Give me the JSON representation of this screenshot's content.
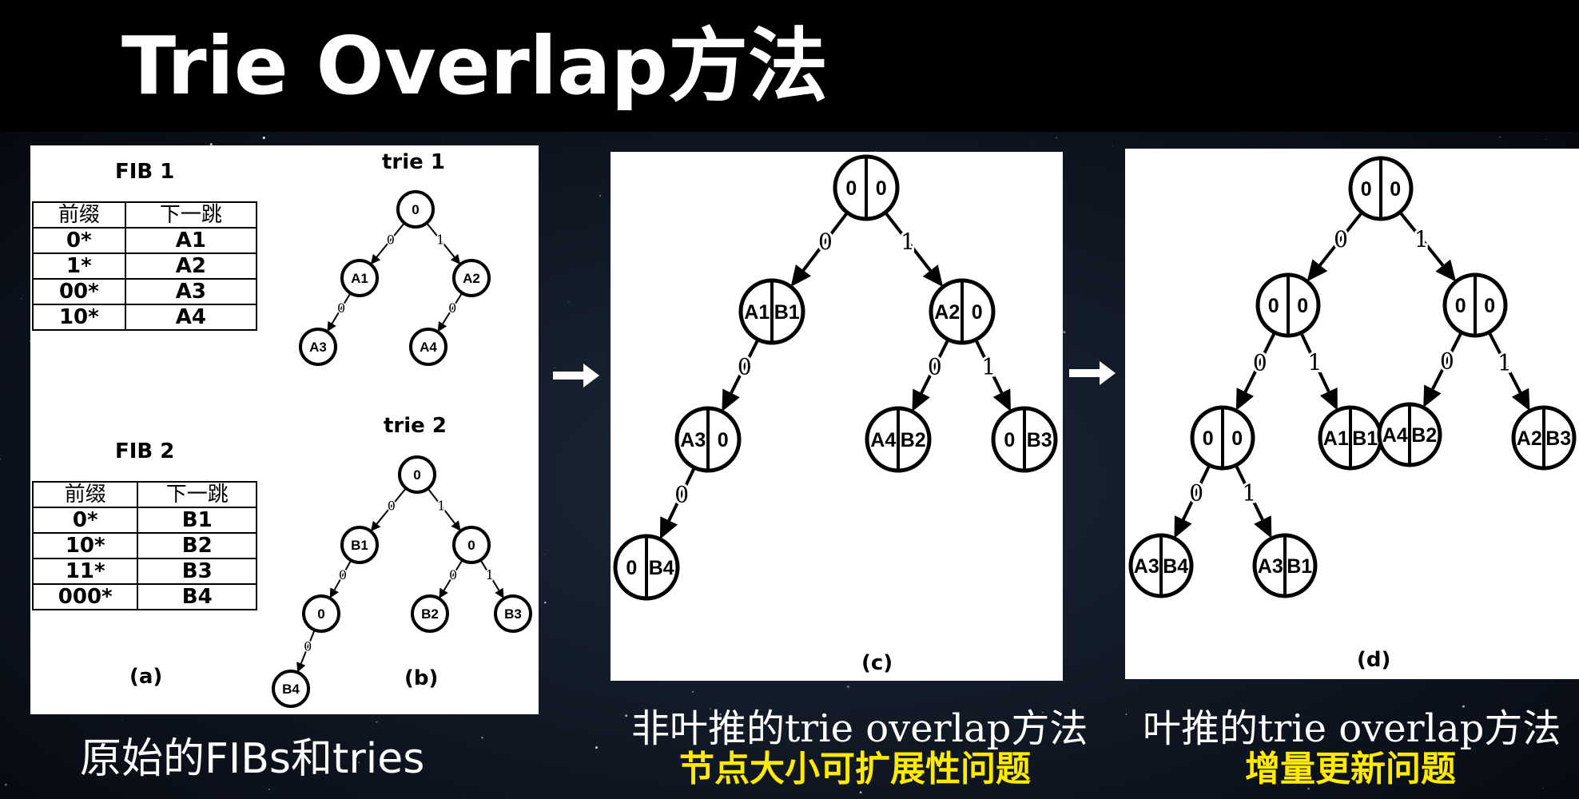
{
  "slide": {
    "title": "Trie Overlap方法"
  },
  "panel_a": {
    "fib1_title": "FIB 1",
    "fib2_title": "FIB 2",
    "col_prefix": "前缀",
    "col_nexthop": "下一跳",
    "fib1_rows": [
      [
        "0*",
        "A1"
      ],
      [
        "1*",
        "A2"
      ],
      [
        "00*",
        "A3"
      ],
      [
        "10*",
        "A4"
      ]
    ],
    "fib2_rows": [
      [
        "0*",
        "B1"
      ],
      [
        "10*",
        "B2"
      ],
      [
        "11*",
        "B3"
      ],
      [
        "000*",
        "B4"
      ]
    ],
    "label_a": "(a)",
    "trie1_title": "trie 1",
    "trie2_title": "trie 2",
    "label_b": "(b)",
    "caption": "原始的FIBs和tries"
  },
  "trie1": {
    "nodes": [
      "0",
      "A1",
      "A2",
      "A3",
      "A4"
    ],
    "edges": [
      "0",
      "1",
      "0",
      "0"
    ]
  },
  "trie2": {
    "nodes": [
      "0",
      "B1",
      "0",
      "0",
      "B2",
      "B3",
      "B4"
    ],
    "edges": [
      "0",
      "1",
      "0",
      "0",
      "1",
      "0"
    ]
  },
  "panel_c": {
    "label": "(c)",
    "nodes": [
      [
        "0",
        "0"
      ],
      [
        "A1",
        "B1"
      ],
      [
        "A2",
        "0"
      ],
      [
        "A3",
        "0"
      ],
      [
        "A4",
        "B2"
      ],
      [
        "0",
        "B3"
      ],
      [
        "0",
        "B4"
      ]
    ],
    "edges": [
      "0",
      "1",
      "0",
      "0",
      "1",
      "0"
    ],
    "caption_line1": "非叶推的trie overlap方法",
    "caption_line2": "节点大小可扩展性问题"
  },
  "panel_d": {
    "label": "(d)",
    "nodes": [
      [
        "0",
        "0"
      ],
      [
        "0",
        "0"
      ],
      [
        "0",
        "0"
      ],
      [
        "0",
        "0"
      ],
      [
        "A1",
        "B1"
      ],
      [
        "A4",
        "B2"
      ],
      [
        "A2",
        "B3"
      ],
      [
        "A3",
        "B4"
      ],
      [
        "A3",
        "B1"
      ]
    ],
    "edges": [
      "0",
      "1",
      "0",
      "1",
      "0",
      "1",
      "0",
      "1"
    ],
    "caption_line1": "叶推的trie overlap方法",
    "caption_line2": "增量更新问题"
  },
  "colors": {
    "background": "#000000",
    "highlight": "#ffea00",
    "text": "#ffffff"
  }
}
